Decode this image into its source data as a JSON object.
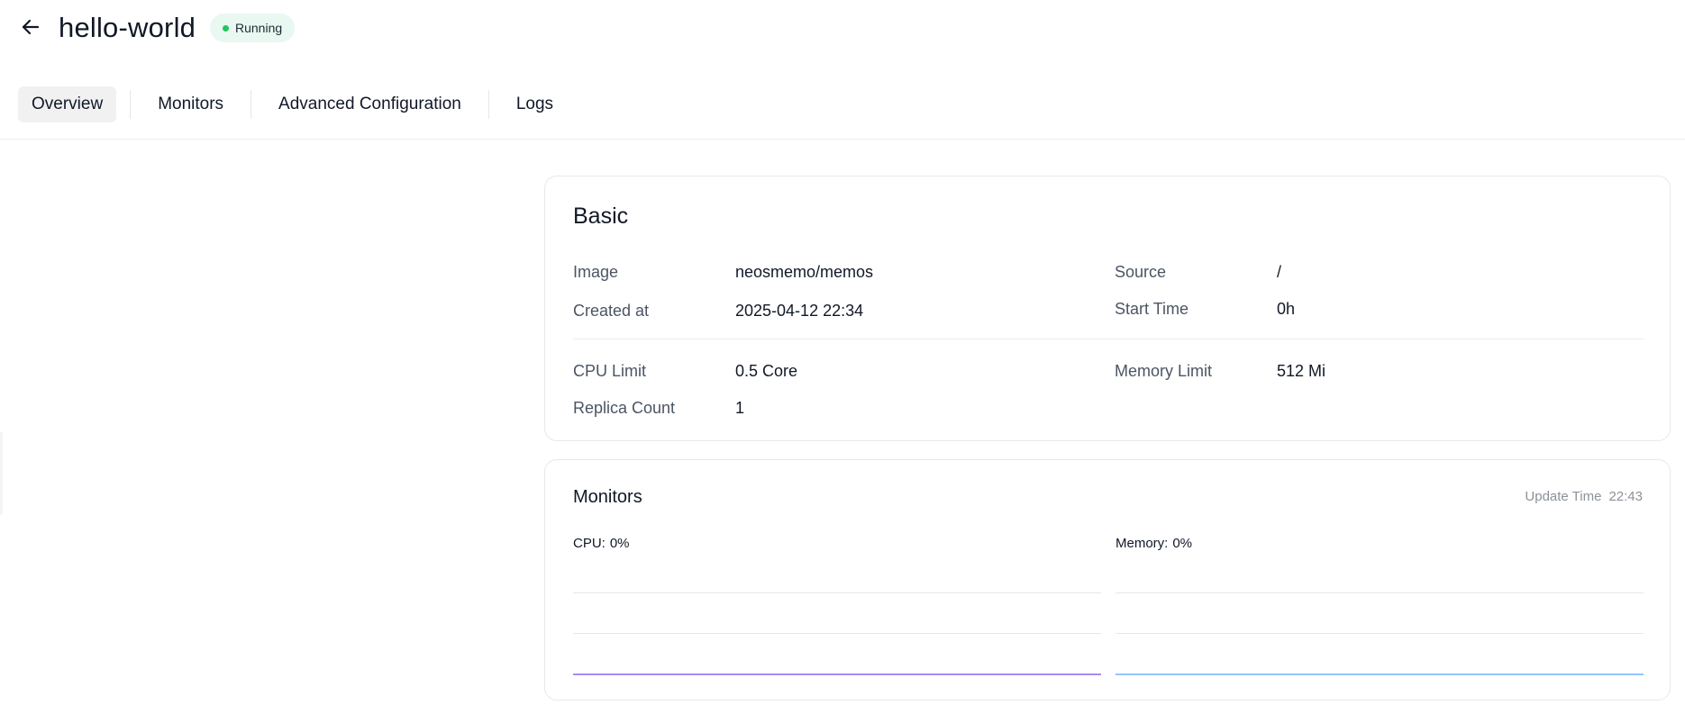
{
  "header": {
    "title": "hello-world",
    "status": "Running",
    "status_color": "#22c55e",
    "back_icon": "arrow-left-icon"
  },
  "tabs": [
    {
      "label": "Overview",
      "active": true
    },
    {
      "label": "Monitors",
      "active": false
    },
    {
      "label": "Advanced Configuration",
      "active": false
    },
    {
      "label": "Logs",
      "active": false
    }
  ],
  "basic": {
    "title": "Basic",
    "image_label": "Image",
    "image_value": "neosmemo/memos",
    "source_label": "Source",
    "source_value": "/",
    "created_label": "Created at",
    "created_value": "2025-04-12 22:34",
    "start_label": "Start Time",
    "start_value": "0h",
    "cpu_label": "CPU Limit",
    "cpu_value": "0.5 Core",
    "memory_label": "Memory Limit",
    "memory_value": "512 Mi",
    "replica_label": "Replica Count",
    "replica_value": "1"
  },
  "monitors": {
    "title": "Monitors",
    "update_label": "Update Time",
    "update_value": "22:43",
    "cpu_label": "CPU:",
    "cpu_value": "0%",
    "memory_label": "Memory:",
    "memory_value": "0%",
    "cpu_line_color": "#a78bfa",
    "memory_line_color": "#93c5fd"
  }
}
